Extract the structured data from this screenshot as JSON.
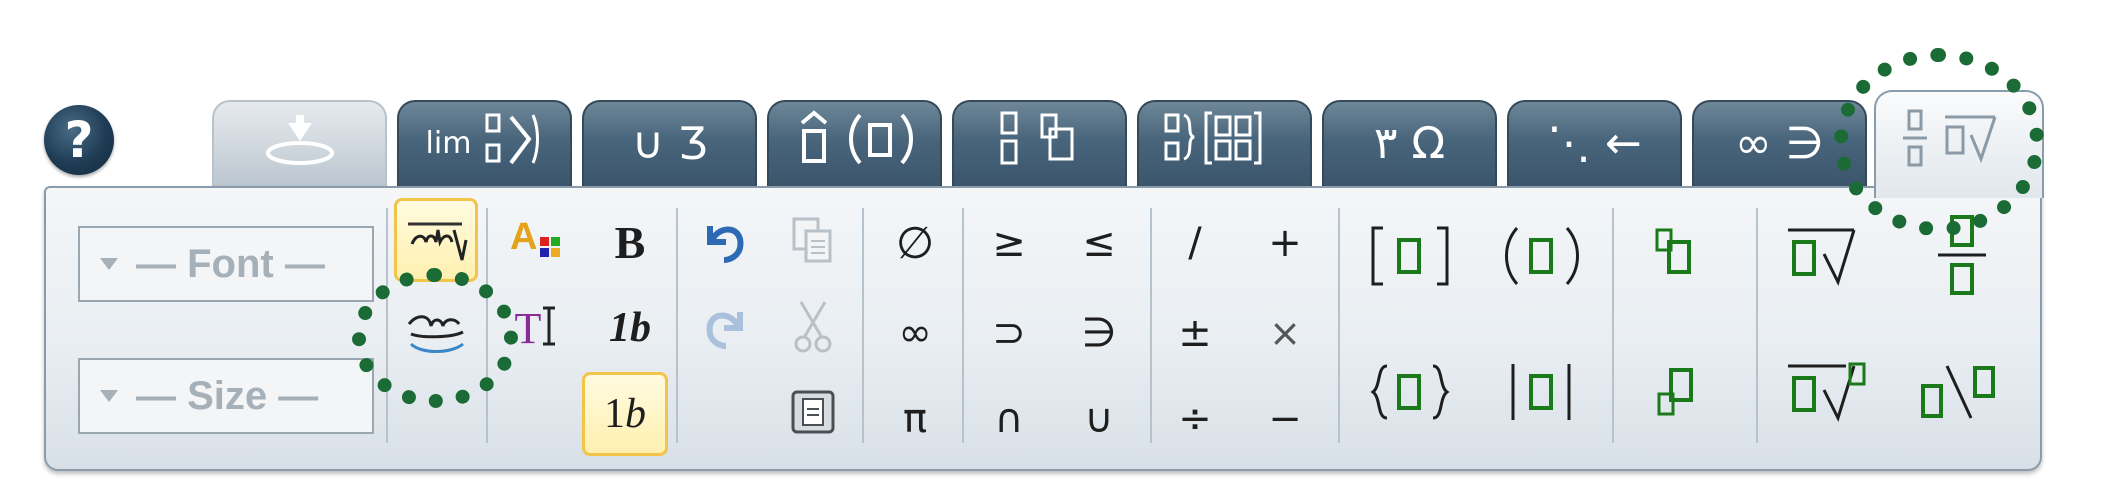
{
  "help": {
    "label": "?"
  },
  "tabs": [
    {
      "name": "tab-paste",
      "label": "",
      "state": "disabled"
    },
    {
      "name": "tab-limits",
      "label": "lim",
      "state": "normal"
    },
    {
      "name": "tab-sets",
      "label": "∪ Ʒ",
      "state": "normal"
    },
    {
      "name": "tab-accents",
      "label": "() ",
      "state": "normal"
    },
    {
      "name": "tab-layouts",
      "label": "",
      "state": "normal"
    },
    {
      "name": "tab-matrices",
      "label": "",
      "state": "normal"
    },
    {
      "name": "tab-greek",
      "label": "٣ Ω",
      "state": "normal"
    },
    {
      "name": "tab-arrows",
      "label": "⋱ ←",
      "state": "normal"
    },
    {
      "name": "tab-symbols",
      "label": "∞ ∋",
      "state": "normal"
    },
    {
      "name": "tab-fractions-radicals",
      "label": "",
      "state": "active"
    }
  ],
  "font_dropdown": {
    "label": "— Font —"
  },
  "size_dropdown": {
    "label": "— Size —"
  },
  "format": {
    "bold": "B",
    "italic_1b": "1b",
    "upright_1b": "1b",
    "text_mode": "T"
  },
  "operators": {
    "empty_set": "∅",
    "infinity": "∞",
    "pi": "π",
    "geq": "≥",
    "leq": "≤",
    "superset": "⊃",
    "ni": "∋",
    "intersection": "∩",
    "union": "∪",
    "slash": "/",
    "plus": "+",
    "plus_minus": "±",
    "times": "×",
    "divide": "÷",
    "minus": "−"
  },
  "colors": {
    "tab_dark": "#49657b",
    "panel": "#e9eef2",
    "highlight_border": "#f2c44a",
    "template_green": "#1a7a1a",
    "annotation_ring": "#1a6b35"
  }
}
